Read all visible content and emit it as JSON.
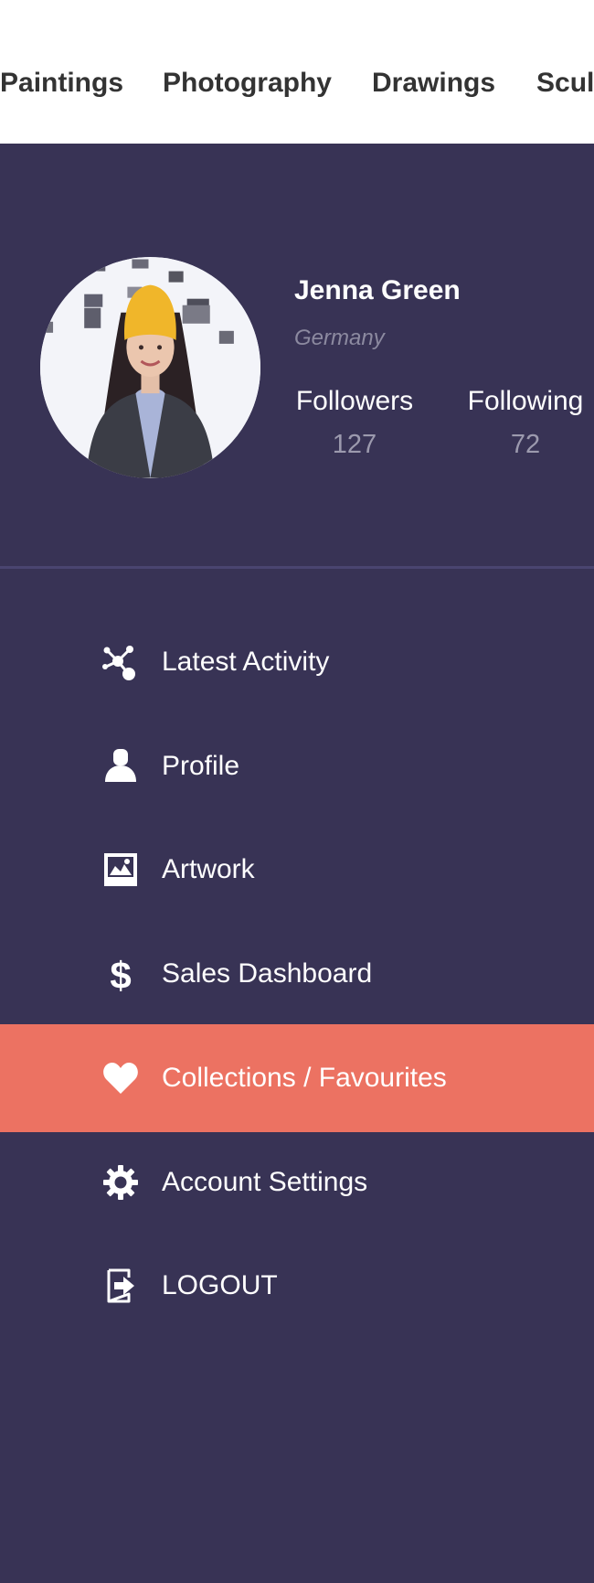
{
  "categories": [
    "Paintings",
    "Photography",
    "Drawings",
    "Sculpture"
  ],
  "profile": {
    "name": "Jenna Green",
    "location": "Germany",
    "stats": [
      {
        "label": "Followers",
        "value": "127"
      },
      {
        "label": "Following",
        "value": "72"
      }
    ]
  },
  "menu": {
    "active_index": 4,
    "items": [
      {
        "label": "Latest Activity",
        "icon": "activity-nodes-icon"
      },
      {
        "label": "Profile",
        "icon": "user-icon"
      },
      {
        "label": "Artwork",
        "icon": "image-icon"
      },
      {
        "label": "Sales Dashboard",
        "icon": "dollar-icon"
      },
      {
        "label": "Collections / Favourites",
        "icon": "heart-icon"
      },
      {
        "label": "Account Settings",
        "icon": "gear-icon"
      },
      {
        "label": "LOGOUT",
        "icon": "logout-icon"
      }
    ]
  },
  "colors": {
    "sidebar_bg": "#383355",
    "active_item_bg": "#ec7262",
    "top_bar_bg": "#ffffff",
    "category_text": "#333333",
    "muted_text": "#8c8aa0"
  }
}
